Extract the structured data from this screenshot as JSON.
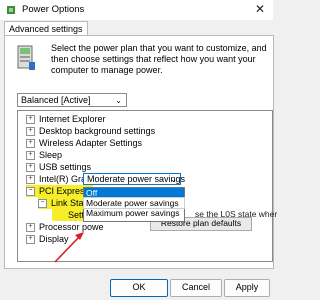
{
  "window": {
    "title": "Power Options",
    "close_glyph": "✕"
  },
  "tab": {
    "label": "Advanced settings"
  },
  "intro": {
    "text": "Select the power plan that you want to customize, and then choose settings that reflect how you want your computer to manage power."
  },
  "plan_select": {
    "value": "Balanced [Active]",
    "chevron": "⌄"
  },
  "tree": {
    "items": [
      {
        "expander": "+",
        "label": "Internet Explorer"
      },
      {
        "expander": "+",
        "label": "Desktop background settings"
      },
      {
        "expander": "+",
        "label": "Wireless Adapter Settings"
      },
      {
        "expander": "+",
        "label": "Sleep"
      },
      {
        "expander": "+",
        "label": "USB settings"
      },
      {
        "expander": "+",
        "label": "Intel(R) Graphics Settings"
      },
      {
        "expander": "−",
        "label": "PCI Express"
      },
      {
        "expander": "−",
        "label": "Link State Power Management"
      },
      {
        "expander": "+",
        "label": "Processor powe"
      },
      {
        "expander": "+",
        "label": "Display"
      }
    ],
    "setting_label": "Setting:",
    "setting_value": "Moderate power savings",
    "setting_chevron": "⌄",
    "options": [
      "Off",
      "Moderate power savings",
      "Maximum power savings"
    ]
  },
  "description_snippet": "se the L0S state wher",
  "restore_button": {
    "label": "Restore plan defaults"
  },
  "buttons": {
    "ok": "OK",
    "cancel": "Cancel",
    "apply": "Apply"
  },
  "colors": {
    "highlight": "#f6ee2a",
    "selection": "#0078d7",
    "annotation_arrow": "#d91f2b"
  }
}
